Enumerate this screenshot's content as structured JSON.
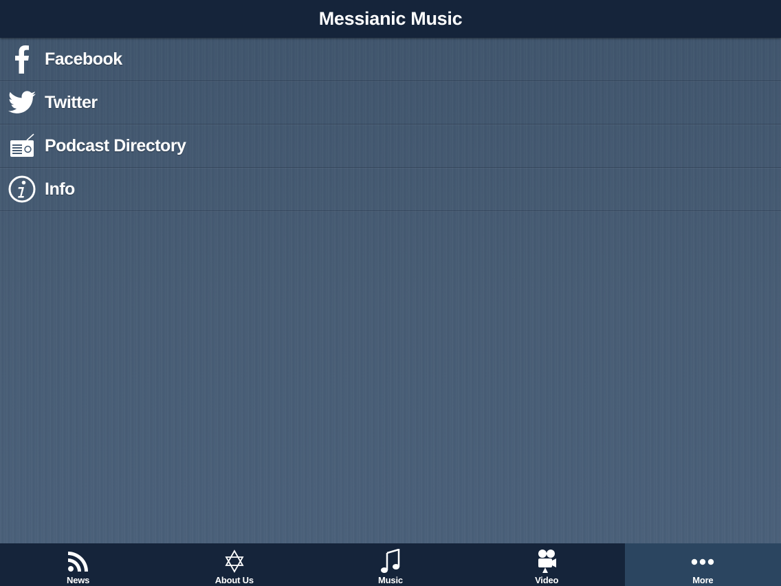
{
  "header": {
    "title": "Messianic Music"
  },
  "menu": {
    "items": [
      {
        "label": "Facebook",
        "icon": "facebook-icon"
      },
      {
        "label": "Twitter",
        "icon": "twitter-icon"
      },
      {
        "label": "Podcast Directory",
        "icon": "radio-icon"
      },
      {
        "label": "Info",
        "icon": "info-icon"
      }
    ]
  },
  "tabbar": {
    "tabs": [
      {
        "label": "News",
        "icon": "rss-icon",
        "active": false
      },
      {
        "label": "About Us",
        "icon": "star-of-david-icon",
        "active": false
      },
      {
        "label": "Music",
        "icon": "music-note-icon",
        "active": false
      },
      {
        "label": "Video",
        "icon": "video-camera-icon",
        "active": false
      },
      {
        "label": "More",
        "icon": "more-dots-icon",
        "active": true
      }
    ]
  },
  "colors": {
    "header_bg": "#15243a",
    "content_bg": "#455a72",
    "tab_active_bg": "#2b4560",
    "text": "#ffffff"
  }
}
